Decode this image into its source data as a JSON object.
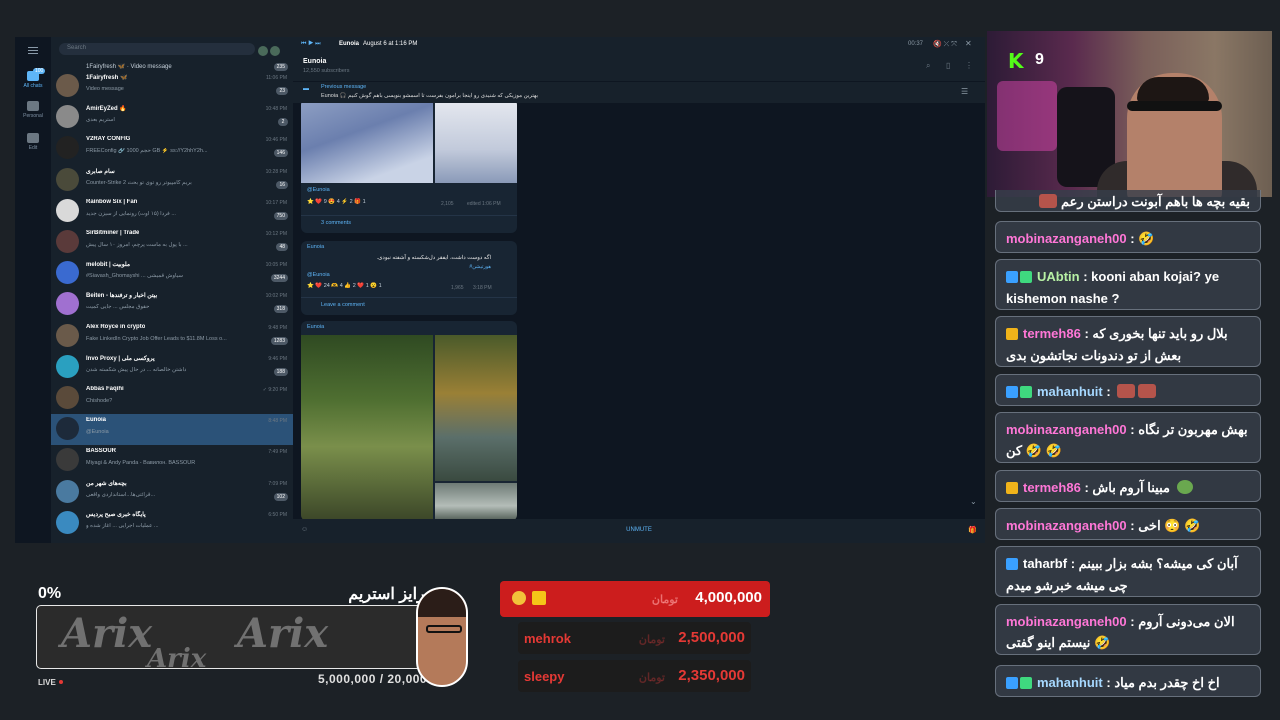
{
  "telegram": {
    "search_placeholder": "Search",
    "folders": [
      {
        "label": "All chats",
        "badge": "100"
      },
      {
        "label": "Personal",
        "badge": ""
      },
      {
        "label": "Edit",
        "badge": ""
      }
    ],
    "chats": [
      {
        "name": "1Fairyfresh 🦋 · Video message",
        "preview": "",
        "time": "",
        "badge": "235"
      },
      {
        "name": "1Fairyfresh 🦋",
        "preview": "Video message",
        "time": "11:06 PM",
        "badge": "23"
      },
      {
        "name": "AmirEyZed 🔥",
        "preview": "استریم بعدی",
        "time": "10:48 PM",
        "badge": "2"
      },
      {
        "name": "V2RAY CONFIG",
        "preview": "FREEConfig 🔗 1000 حجم GB ⚡ ss://Y2hhY2h...",
        "time": "10:46 PM",
        "badge": "146"
      },
      {
        "name": "سام صابری",
        "preview": "Counter-Strike 2 بریم کامپیوتر رو توی تو بحث",
        "time": "10:28 PM",
        "badge": "16"
      },
      {
        "name": "Rainbow Six | Fan",
        "preview": "فردا (۱۵ اوت) رونمایی از سیزن جدید ...",
        "time": "10:17 PM",
        "badge": "750"
      },
      {
        "name": "SirBitminer | Trade",
        "preview": "با پول به ماست پرچم، امروز ۱۰ سال پیش ...",
        "time": "10:12 PM",
        "badge": "48"
      },
      {
        "name": "melobit | ملوبیت",
        "preview": "#Siavash_Ghomayshi ... سیاوش قمیشی",
        "time": "10:05 PM",
        "badge": "3244"
      },
      {
        "name": "Beiten - بیتن اخبار و ترفندها",
        "preview": "حقوق مجلس ... جایی کمیت",
        "time": "10:02 PM",
        "badge": "318"
      },
      {
        "name": "Alex Royce in crypto",
        "preview": "Fake LinkedIn Crypto Job Offer Leads to $11.8M Loss o...",
        "time": "9:48 PM",
        "badge": "1283"
      },
      {
        "name": "Invo Proxy | پروکسی ملی",
        "preview": "داشتن خالصانه ... در حال پیش شکسته شدن",
        "time": "9:46 PM",
        "badge": "188"
      },
      {
        "name": "Abbas Faqihi",
        "preview": "Chishode?",
        "time": "✓ 9:20 PM",
        "badge": ""
      },
      {
        "name": "Eunoia",
        "preview": "@Eunoia",
        "time": "8:48 PM",
        "badge": ""
      },
      {
        "name": "BASSOUR",
        "preview": "Miyagi & Andy Panda - Вавилон. BASSOUR",
        "time": "7:49 PM",
        "badge": ""
      },
      {
        "name": "بچه‌های شهر من",
        "preview": "قرائتی‌ها...استانداردی واقعی...",
        "time": "7:09 PM",
        "badge": "102"
      },
      {
        "name": "پایگاه خبری صبح پردیس",
        "preview": "عملیات اجرایی ... آغاز شده و ...",
        "time": "6:50 PM",
        "badge": ""
      }
    ],
    "player": {
      "title": "Eunoia",
      "date": "August 6 at 1:16 PM",
      "time": "00:37"
    },
    "channel": {
      "name": "Eunoia",
      "subscribers": "12,550 subscribers"
    },
    "pinned": {
      "title": "Previous message",
      "text": "Eunoia 🎧 بهترین موزیکی که شنیدی رو اینجا برامون بفرست تا اسمشو بنویسی باهم گوش کنیم"
    },
    "posts": [
      {
        "handle": "@Eunoia",
        "reactions": "⭐ ❤️ 9 😍 4 ⚡ 2 🎁 1",
        "views": "2,105",
        "edited": "edited 1:06 PM",
        "comments": "3 comments"
      },
      {
        "author": "Eunoia",
        "text": "اگه دوست داشت، ایفقر دل‌شکسته و آشفته نبودی.",
        "tag": "#هورتیشن",
        "handle": "@Eunoia",
        "reactions": "⭐ ❤️ 24 🫶 4 👍 2 ❤️ 1 😮 1",
        "views": "1,965",
        "time": "3:18 PM",
        "comments": "Leave a comment"
      },
      {
        "author": "Eunoia"
      }
    ],
    "unmute": "UNMUTE"
  },
  "stream": {
    "kick_viewers": "9",
    "chat": [
      {
        "user": "",
        "text": "بقیه بچه ها باهم آبونت دراستن رعم",
        "color": "#ffffff"
      },
      {
        "user": "mobinazanganeh00",
        "text": ": 🤣",
        "color": "#ff77d7"
      },
      {
        "user": "UAbtin",
        "text": ": kooni aban kojai? ye kishemon nashe ?",
        "color": "#b7f0a4"
      },
      {
        "user": "termeh86",
        "text": ": بلال رو باید تنها بخوری که بعش از تو دندونات نجاتشون بدی",
        "color": "#ff77d7"
      },
      {
        "user": "mahanhuit",
        "text": ":",
        "color": "#a6d8ff"
      },
      {
        "user": "mobinazanganeh00",
        "text": ": بهش مهربون تر نگاه کن 🤣 🤣",
        "color": "#ff77d7"
      },
      {
        "user": "termeh86",
        "text": ": مبینا آروم باش",
        "color": "#ff77d7"
      },
      {
        "user": "mobinazanganeh00",
        "text": ": اخی 😳 🤣",
        "color": "#ff77d7"
      },
      {
        "user": "taharbf",
        "text": ": آبان کی میشه؟ بشه بزار ببینم چی میشه خبرشو میدم",
        "color": "#ffffff"
      },
      {
        "user": "mobinazanganeh00",
        "text": ": الان می‌دونی آروم نیستم اینو گفتی 🤣",
        "color": "#ff77d7"
      },
      {
        "user": "mahanhuit",
        "text": ": اخ اخ چقدر بدم میاد",
        "color": "#a6d8ff"
      }
    ],
    "progress": {
      "percent_label": "0%",
      "title": "سوپرایز استریم",
      "amount": "5,000,000 / 20,000",
      "live": "LIVE",
      "fraction": 0,
      "brand": "Arix"
    },
    "donations": [
      {
        "name": "",
        "amount": "4,000,000",
        "unit": "تومان"
      },
      {
        "name": "mehrok",
        "amount": "2,500,000",
        "unit": "تومان"
      },
      {
        "name": "sleepy",
        "amount": "2,350,000",
        "unit": "تومان"
      }
    ]
  }
}
